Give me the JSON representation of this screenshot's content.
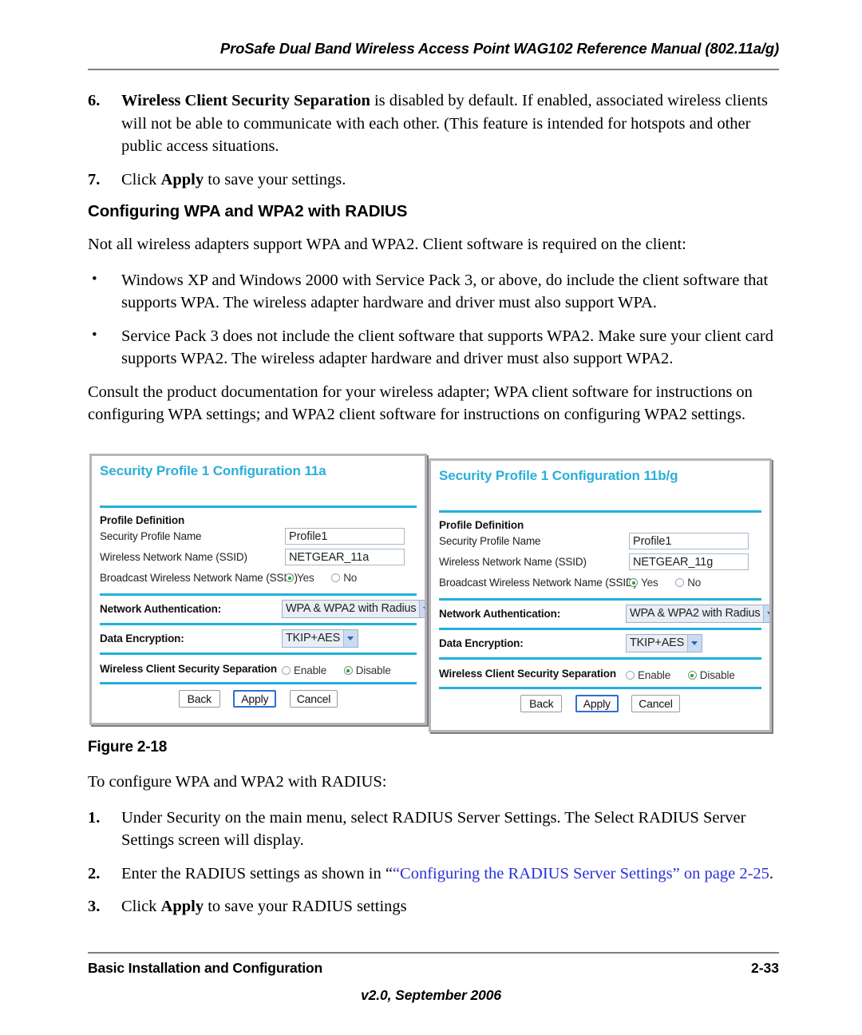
{
  "header": {
    "running_title": "ProSafe Dual Band Wireless Access Point WAG102 Reference Manual (802.11a/g)"
  },
  "body": {
    "step6": {
      "num": "6.",
      "bold_lead": "Wireless Client Security Separation",
      "rest": " is disabled by default. If enabled, associated wireless clients will not be able to communicate with each other. (This feature is intended for hotspots and other public access situations."
    },
    "step7": {
      "num": "7.",
      "pre": "Click ",
      "bold": "Apply",
      "post": " to save your settings."
    },
    "section_title": "Configuring WPA and WPA2 with RADIUS",
    "intro": "Not all wireless adapters support WPA and WPA2. Client software is required on the client:",
    "bullets": [
      "Windows XP and Windows 2000 with Service Pack 3, or above, do include the client software that supports WPA. The wireless adapter hardware and driver must also support WPA.",
      "Service Pack 3 does not include the client software that supports WPA2. Make sure your client card supports WPA2. The wireless adapter hardware and driver must also support WPA2."
    ],
    "consult": "Consult the product documentation for your wireless adapter; WPA client software for instructions on configuring WPA settings; and WPA2 client software for instructions on configuring WPA2 settings.",
    "figure_caption": "Figure 2-18",
    "to_configure": "To configure WPA and WPA2 with RADIUS:",
    "steps": [
      {
        "num": "1.",
        "text": "Under Security on the main menu, select RADIUS Server Settings. The Select RADIUS Server Settings screen will display."
      },
      {
        "num": "2.",
        "pre": "Enter the RADIUS settings as shown in “",
        "link": "“Configuring the RADIUS Server Settings” on page 2-25",
        "post": "."
      },
      {
        "num": "3.",
        "pre": "Click ",
        "bold": "Apply",
        "post": " to save your RADIUS settings"
      }
    ]
  },
  "figure": {
    "panels": [
      {
        "title": "Security Profile 1 Configuration 11a",
        "profile_definition_label": "Profile Definition",
        "fields": {
          "security_profile_name_label": "Security Profile Name",
          "security_profile_name_value": "Profile1",
          "ssid_label": "Wireless Network Name (SSID)",
          "ssid_value": "NETGEAR_11a",
          "broadcast_label": "Broadcast Wireless Network Name (SSID)",
          "broadcast_yes": "Yes",
          "broadcast_no": "No",
          "broadcast_selected": "Yes",
          "network_auth_label": "Network Authentication:",
          "network_auth_value": "WPA & WPA2 with Radius",
          "data_encryption_label": "Data Encryption:",
          "data_encryption_value": "TKIP+AES",
          "separation_label": "Wireless Client Security Separation",
          "separation_enable": "Enable",
          "separation_disable": "Disable",
          "separation_selected": "Disable"
        },
        "buttons": {
          "back": "Back",
          "apply": "Apply",
          "cancel": "Cancel"
        }
      },
      {
        "title": "Security Profile 1 Configuration 11b/g",
        "profile_definition_label": "Profile Definition",
        "fields": {
          "security_profile_name_label": "Security Profile Name",
          "security_profile_name_value": "Profile1",
          "ssid_label": "Wireless Network Name (SSID)",
          "ssid_value": "NETGEAR_11g",
          "broadcast_label": "Broadcast Wireless Network Name (SSID)",
          "broadcast_yes": "Yes",
          "broadcast_no": "No",
          "broadcast_selected": "Yes",
          "network_auth_label": "Network Authentication:",
          "network_auth_value": "WPA & WPA2 with Radius",
          "data_encryption_label": "Data Encryption:",
          "data_encryption_value": "TKIP+AES",
          "separation_label": "Wireless Client Security Separation",
          "separation_enable": "Enable",
          "separation_disable": "Disable",
          "separation_selected": "Disable"
        },
        "buttons": {
          "back": "Back",
          "apply": "Apply",
          "cancel": "Cancel"
        }
      }
    ]
  },
  "footer": {
    "left": "Basic Installation and Configuration",
    "page_number": "2-33",
    "version": "v2.0, September 2006"
  },
  "colors": {
    "panel_title": "#2aafd8",
    "divider": "#23b0da",
    "link": "#2b31d8",
    "radio_on": "#1f9f38",
    "rule": "#808080"
  }
}
